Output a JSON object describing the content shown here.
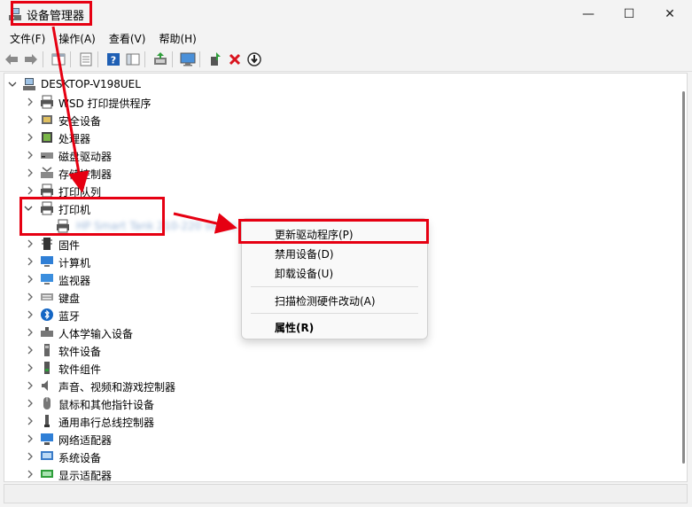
{
  "window": {
    "title": "设备管理器",
    "minimize_glyph": "—",
    "maximize_glyph": "☐",
    "close_glyph": "✕"
  },
  "menu": [
    "文件(F)",
    "操作(A)",
    "查看(V)",
    "帮助(H)"
  ],
  "toolbar_icons": [
    "back-arrow-icon",
    "forward-arrow-icon",
    "properties-window-icon",
    "list-view-icon",
    "help-icon",
    "panel-view-icon",
    "update-driver-icon",
    "monitor-scan-icon",
    "enable-device-icon",
    "uninstall-x-icon",
    "download-circle-icon"
  ],
  "tree": {
    "root": "DESKTOP-V198UEL",
    "items": [
      {
        "label": "WSD 打印提供程序",
        "icon": "printer-icon"
      },
      {
        "label": "安全设备",
        "icon": "security-icon"
      },
      {
        "label": "处理器",
        "icon": "processor-icon"
      },
      {
        "label": "磁盘驱动器",
        "icon": "disk-icon"
      },
      {
        "label": "存储控制器",
        "icon": "storage-icon"
      },
      {
        "label": "打印队列",
        "icon": "printer-icon"
      },
      {
        "label": "打印机",
        "icon": "printer-icon",
        "expanded": true
      },
      {
        "label": "固件",
        "icon": "firmware-icon"
      },
      {
        "label": "计算机",
        "icon": "computer-icon"
      },
      {
        "label": "监视器",
        "icon": "monitor-icon"
      },
      {
        "label": "键盘",
        "icon": "keyboard-icon"
      },
      {
        "label": "蓝牙",
        "icon": "bluetooth-icon"
      },
      {
        "label": "人体学输入设备",
        "icon": "hid-icon"
      },
      {
        "label": "软件设备",
        "icon": "software-device-icon"
      },
      {
        "label": "软件组件",
        "icon": "software-component-icon"
      },
      {
        "label": "声音、视频和游戏控制器",
        "icon": "audio-icon"
      },
      {
        "label": "鼠标和其他指针设备",
        "icon": "mouse-icon"
      },
      {
        "label": "通用串行总线控制器",
        "icon": "usb-icon"
      },
      {
        "label": "网络适配器",
        "icon": "network-icon"
      },
      {
        "label": "系统设备",
        "icon": "system-icon"
      },
      {
        "label": "显示适配器",
        "icon": "display-adapter-icon"
      }
    ],
    "child_device": "HP Smart Tank 210-220 series"
  },
  "context_menu": {
    "items": [
      "更新驱动程序(P)",
      "禁用设备(D)",
      "卸载设备(U)",
      "扫描检测硬件改动(A)",
      "属性(R)"
    ]
  },
  "colors": {
    "annotation_red": "#e60012",
    "accent_blue": "#0067c0"
  }
}
